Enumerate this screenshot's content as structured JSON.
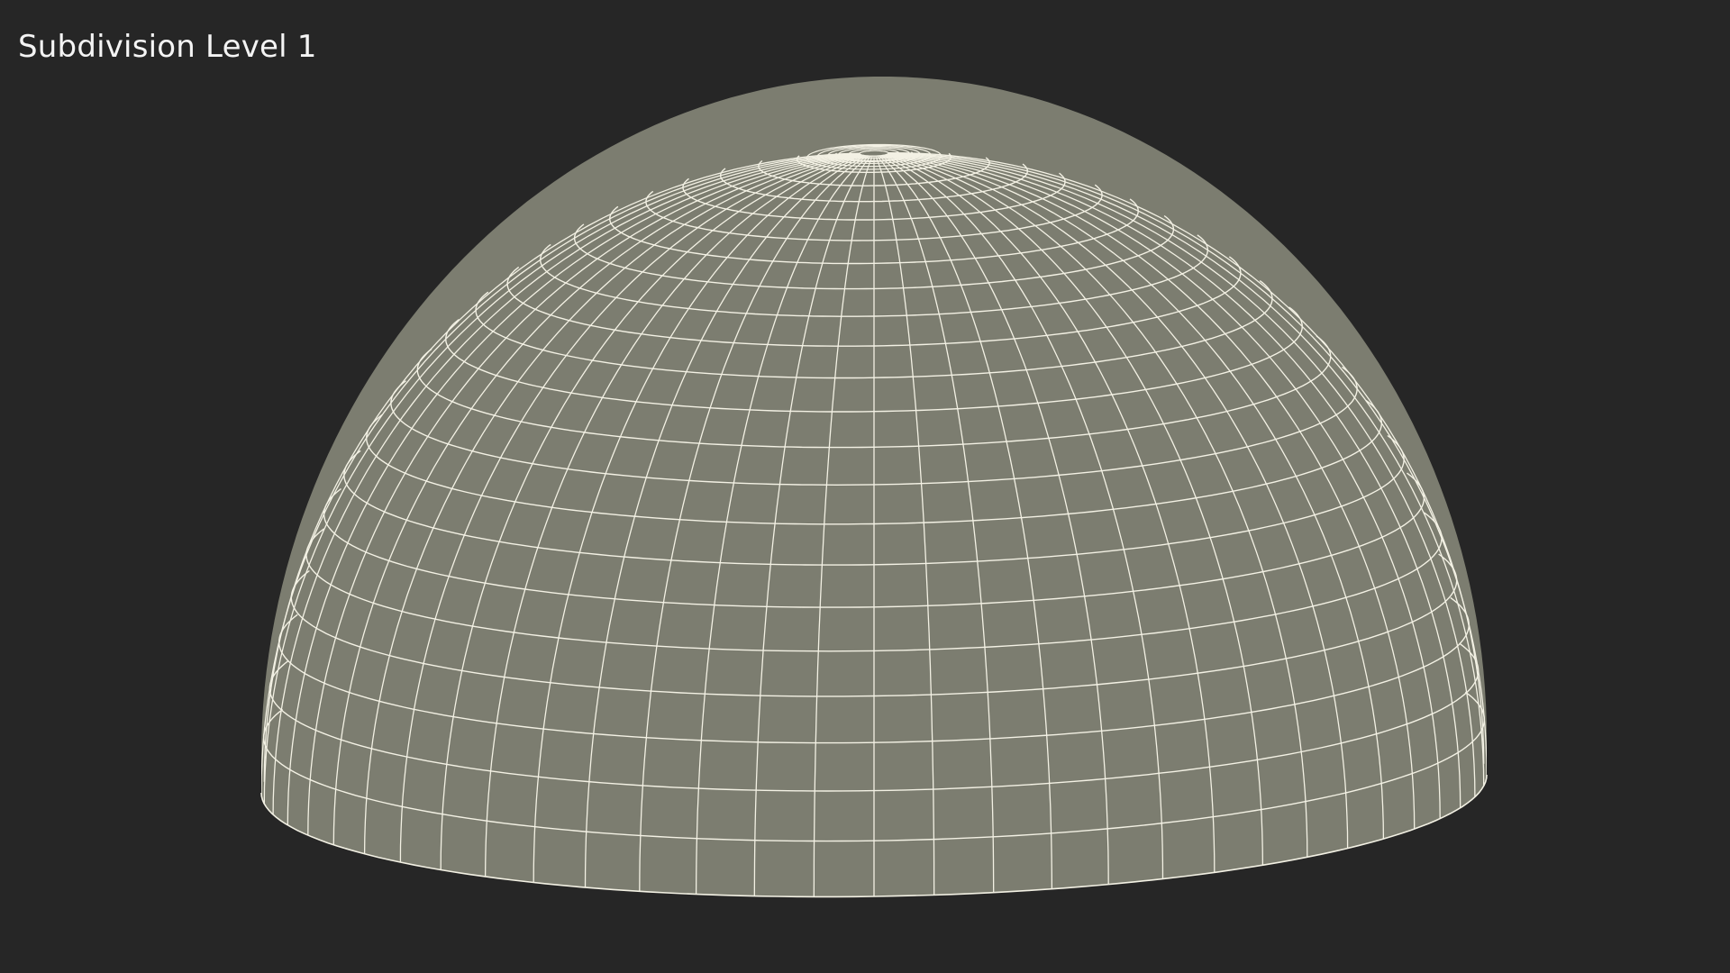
{
  "caption": "Subdivision Level 1",
  "colors": {
    "background": "#262626",
    "surface": "#7c7d70",
    "wire": "#f3f1e4",
    "caption": "#f4f4f4"
  },
  "mesh": {
    "object": "hemisphere-dome",
    "render_mode": "wireframe-on-shaded",
    "meridian_count": 64,
    "ring_count": 22
  }
}
